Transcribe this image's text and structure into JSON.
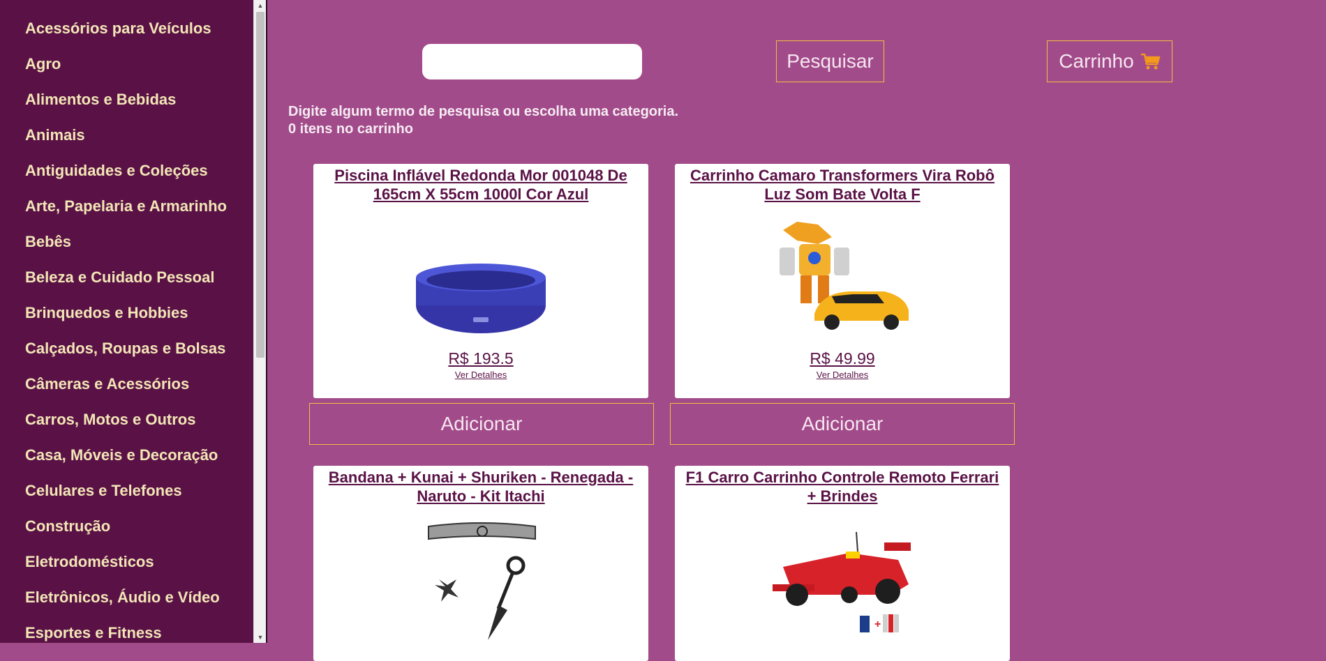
{
  "sidebar": {
    "categories": [
      "Acessórios para Veículos",
      "Agro",
      "Alimentos e Bebidas",
      "Animais",
      "Antiguidades e Coleções",
      "Arte, Papelaria e Armarinho",
      "Bebês",
      "Beleza e Cuidado Pessoal",
      "Brinquedos e Hobbies",
      "Calçados, Roupas e Bolsas",
      "Câmeras e Acessórios",
      "Carros, Motos e Outros",
      "Casa, Móveis e Decoração",
      "Celulares e Telefones",
      "Construção",
      "Eletrodomésticos",
      "Eletrônicos, Áudio e Vídeo",
      "Esportes e Fitness"
    ]
  },
  "header": {
    "search_placeholder": "",
    "search_value": "",
    "search_button": "Pesquisar",
    "cart_button": "Carrinho"
  },
  "info": {
    "prompt": "Digite algum termo de pesquisa ou escolha uma categoria.",
    "cart_count": "0 itens no carrinho"
  },
  "products": [
    {
      "title": "Piscina Inflável Redonda Mor 001048 De 165cm X 55cm 1000l Cor Azul",
      "price": "R$ 193.5",
      "details_link": "Ver Detalhes",
      "add_button": "Adicionar",
      "image_icon": "pool-image"
    },
    {
      "title": "Carrinho Camaro Transformers Vira Robô Luz Som Bate Volta F",
      "price": "R$ 49.99",
      "details_link": "Ver Detalhes",
      "add_button": "Adicionar",
      "image_icon": "robot-car-image"
    },
    {
      "title": "Bandana + Kunai + Shuriken - Renegada - Naruto - Kit Itachi",
      "image_icon": "ninja-kit-image"
    },
    {
      "title": "F1 Carro Carrinho Controle Remoto Ferrari + Brindes",
      "image_icon": "f1-car-image"
    }
  ],
  "colors": {
    "background": "#a24b8a",
    "sidebar": "#5a1246",
    "sidebar_text": "#f2e6b6",
    "button_border": "#f0c040",
    "link": "#5a1246"
  }
}
